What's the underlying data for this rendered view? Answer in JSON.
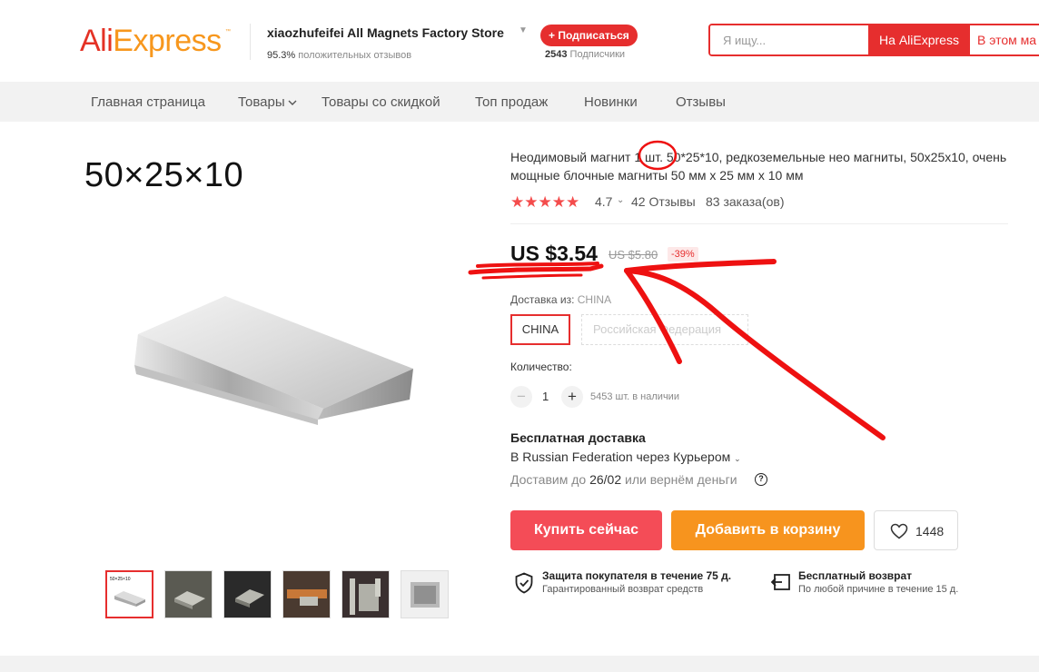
{
  "header": {
    "logo_part1": "Ali",
    "logo_part2": "Express",
    "store_name": "xiaozhufeifei All Magnets Factory Store",
    "store_rating_value": "95.3%",
    "store_rating_text": "положительных отзывов",
    "subscribe_label": "+ Подписаться",
    "subscribers_count": "2543",
    "subscribers_text": "Подписчики",
    "search": {
      "placeholder": "Я ищу...",
      "aliexpress_button": "На AliExpress",
      "store_button": "В этом ма"
    }
  },
  "nav": {
    "items": [
      {
        "label": "Главная страница"
      },
      {
        "label": "Товары"
      },
      {
        "label": "Товары со скидкой"
      },
      {
        "label": "Топ продаж"
      },
      {
        "label": "Новинки"
      },
      {
        "label": "Отзывы"
      }
    ]
  },
  "gallery": {
    "dimension_label": "50×25×10",
    "thumbnail_label": "50×25×10"
  },
  "product": {
    "title": "Неодимовый магнит 1 шт. 50*25*10, редкоземельные нео магниты, 50x25x10, очень мощные блочные магниты 50 мм x 25 мм x 10 мм",
    "stars": "★★★★★",
    "rating": "4.7",
    "reviews": "42 Отзывы",
    "orders": "83 заказа(ов)",
    "price": "US $3.54",
    "old_price": "US $5.80",
    "discount": "-39%",
    "ship_from_label": "Доставка из:",
    "ship_from_value": "CHINA",
    "ship_options": [
      "CHINA",
      "Российская Федерация"
    ],
    "quantity_label": "Количество:",
    "quantity": "1",
    "stock": "5453 шт. в наличии",
    "free_shipping": "Бесплатная доставка",
    "ship_via": "В Russian Federation через Курьером",
    "deliver_prefix": "Доставим до",
    "deliver_date": "26/02",
    "deliver_suffix": "или вернём деньги",
    "buy_now": "Купить сейчас",
    "add_to_cart": "Добавить в корзину",
    "wishlist_count": "1448",
    "guarantee_title": "Защита покупателя в течение 75 д.",
    "guarantee_sub": "Гарантированный возврат средств",
    "return_title": "Бесплатный возврат",
    "return_sub": "По любой причине в течение 15 д."
  },
  "colors": {
    "accent": "#e62e2e",
    "buy": "#f44c57",
    "cart": "#f7941e",
    "annotation": "#ee1111"
  },
  "icons": [
    "question-icon",
    "heart-icon",
    "shield-check-icon",
    "return-icon",
    "chevron-down-icon"
  ]
}
